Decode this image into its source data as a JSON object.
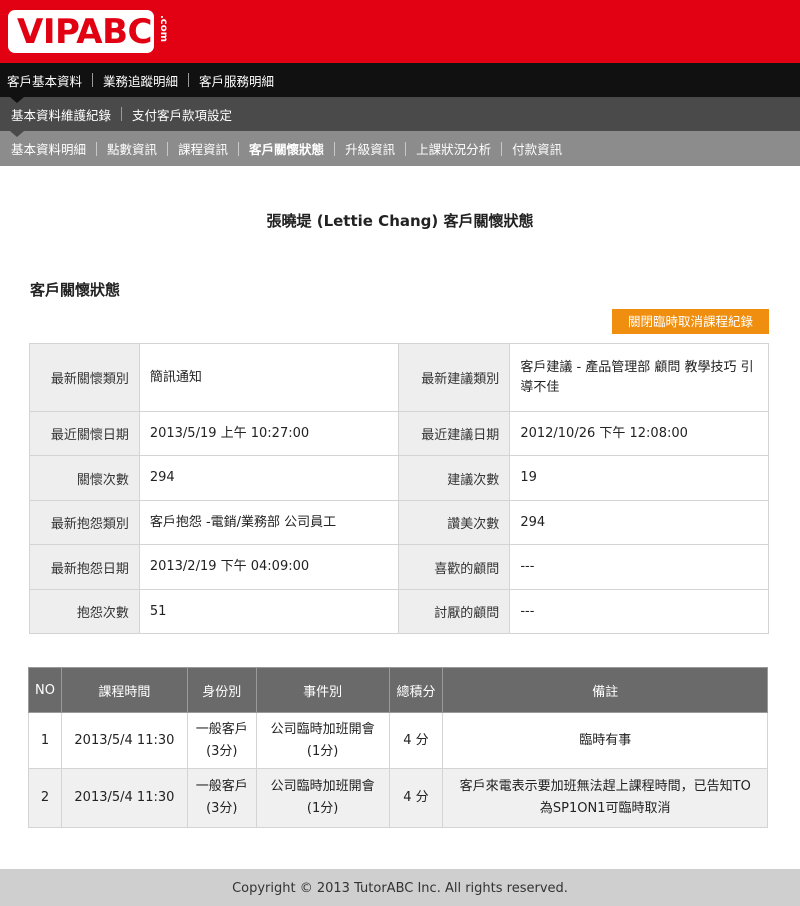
{
  "brand": {
    "logo_text": "VIPABC",
    "logo_suffix": ".com"
  },
  "nav1": [
    "客戶基本資料",
    "業務追蹤明細",
    "客戶服務明細"
  ],
  "nav2": [
    "基本資料維護紀錄",
    "支付客戶款項設定"
  ],
  "nav3": [
    "基本資料明細",
    "點數資訊",
    "課程資訊",
    "客戶關懷狀態",
    "升級資訊",
    "上課狀況分析",
    "付款資訊"
  ],
  "page_title": "張曉堤 (Lettie Chang) 客戶關懷狀態",
  "section_title": "客戶關懷狀態",
  "cancel_record_button": "關閉臨時取消課程紀錄",
  "info_rows": [
    {
      "left_label": "最新關懷類別",
      "left_value": "簡訊通知",
      "right_label": "最新建議類別",
      "right_value": "客戶建議 - 產品管理部 顧問 教學技巧 引導不佳"
    },
    {
      "left_label": "最近關懷日期",
      "left_value": "2013/5/19 上午 10:27:00",
      "right_label": "最近建議日期",
      "right_value": "2012/10/26 下午 12:08:00"
    },
    {
      "left_label": "關懷次數",
      "left_value": "294",
      "right_label": "建議次數",
      "right_value": "19"
    },
    {
      "left_label": "最新抱怨類別",
      "left_value": "客戶抱怨 -電銷/業務部 公司員工",
      "right_label": "讚美次數",
      "right_value": "294"
    },
    {
      "left_label": "最新抱怨日期",
      "left_value": "2013/2/19 下午 04:09:00",
      "right_label": "喜歡的顧問",
      "right_value": "---"
    },
    {
      "left_label": "抱怨次數",
      "left_value": "51",
      "right_label": "討厭的顧問",
      "right_value": "---"
    }
  ],
  "list_headers": [
    "NO",
    "課程時間",
    "身份別",
    "事件別",
    "總積分",
    "備註"
  ],
  "list_rows": [
    {
      "no": "1",
      "time": "2013/5/4 11:30",
      "identity_line1": "一般客戶",
      "identity_line2": "(3分)",
      "event_line1": "公司臨時加班開會",
      "event_line2": "(1分)",
      "score": "4 分",
      "note": "臨時有事"
    },
    {
      "no": "2",
      "time": "2013/5/4 11:30",
      "identity_line1": "一般客戶",
      "identity_line2": "(3分)",
      "event_line1": "公司臨時加班開會",
      "event_line2": "(1分)",
      "score": "4 分",
      "note": "客戶來電表示要加班無法趕上課程時間，已告知TO為SP1ON1可臨時取消"
    }
  ],
  "footer": "Copyright © 2013 TutorABC Inc. All rights reserved.",
  "colors": {
    "brand_red": "#e20013",
    "accent_orange": "#ef8e0f"
  }
}
